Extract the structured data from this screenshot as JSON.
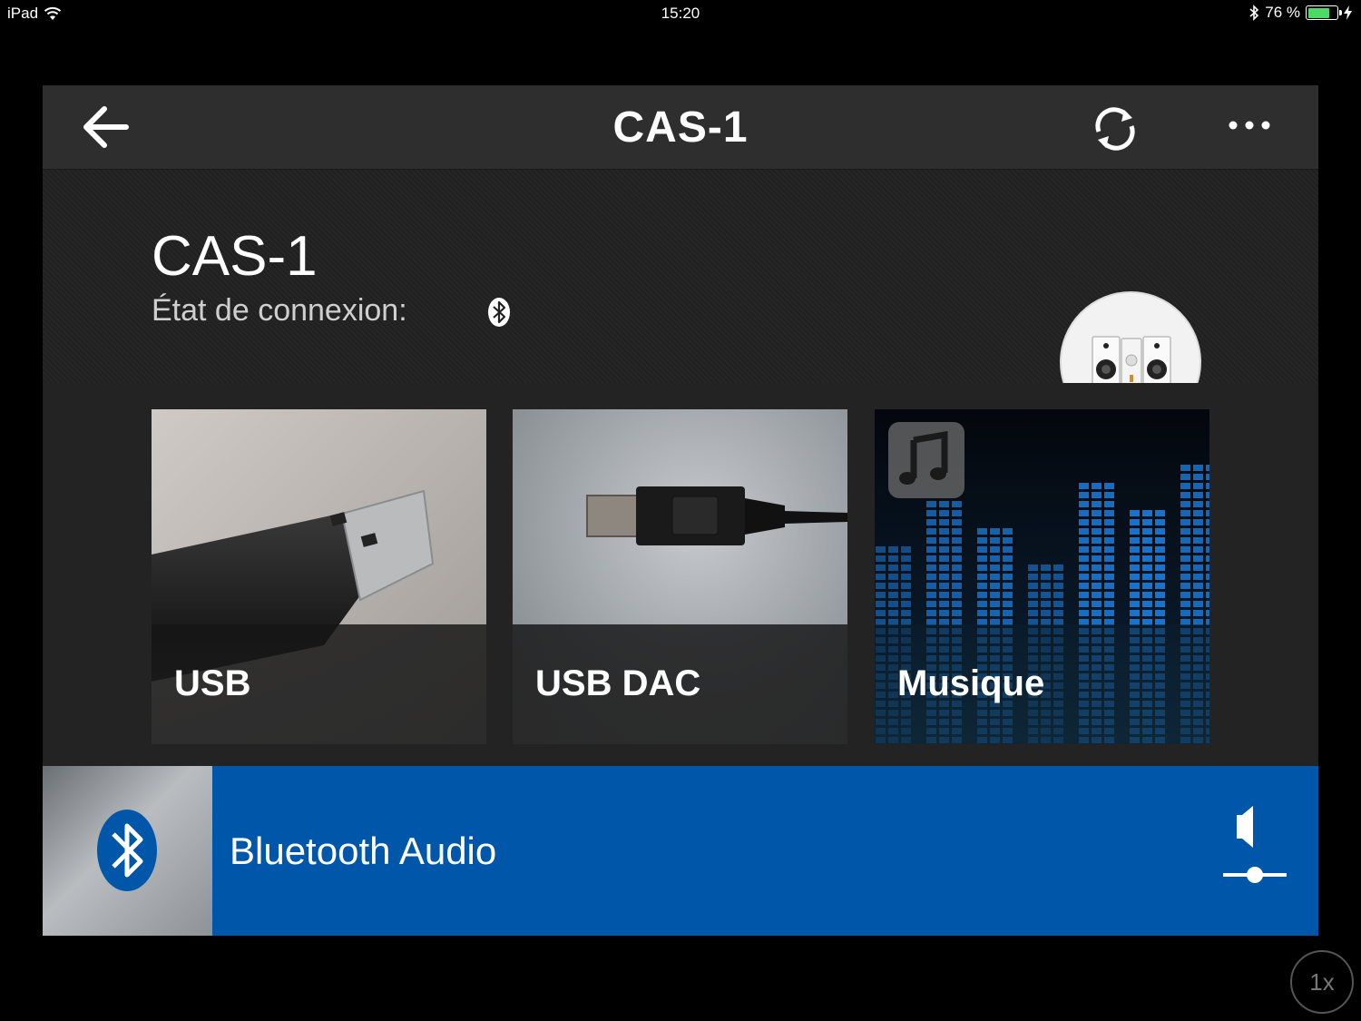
{
  "status_bar": {
    "device": "iPad",
    "time": "15:20",
    "battery": "76 %",
    "battery_level": 0.76
  },
  "nav": {
    "title": "CAS-1",
    "back_icon": "arrow-left-icon",
    "refresh_icon": "refresh-icon",
    "more_icon": "more-dots-icon"
  },
  "device": {
    "name": "CAS-1",
    "connection_label": "État de connexion:",
    "connection_icon": "bluetooth-icon"
  },
  "sources": [
    {
      "label": "USB",
      "icon": "usb-stick-image"
    },
    {
      "label": "USB DAC",
      "icon": "usb-b-cable-image"
    },
    {
      "label": "Musique",
      "icon": "music-note-icon"
    }
  ],
  "now_playing": {
    "title": "Bluetooth Audio",
    "icon": "bluetooth-icon",
    "volume_icon": "volume-slider-icon",
    "accent": "#0057aa"
  },
  "zoom": "1x"
}
